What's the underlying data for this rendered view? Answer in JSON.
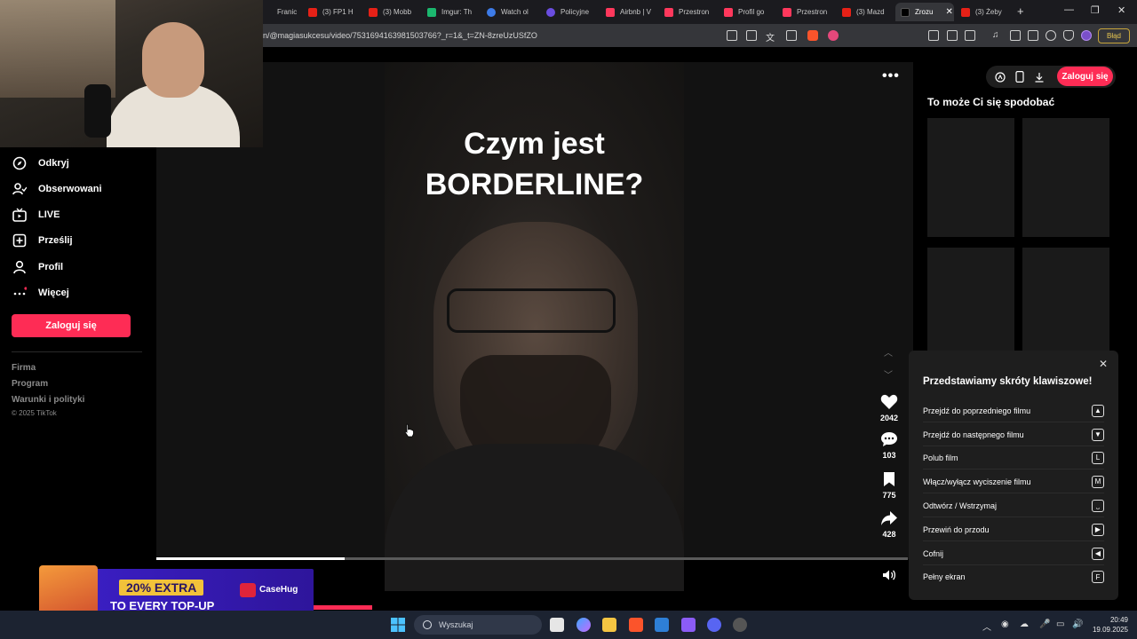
{
  "browser": {
    "tabs": [
      {
        "label": "Franic",
        "color": "#2a2a2a"
      },
      {
        "label": "(3) FP1 H",
        "color": "#e62117"
      },
      {
        "label": "(3) Mobb",
        "color": "#e62117"
      },
      {
        "label": "Imgur: Th",
        "color": "#1bb76e"
      },
      {
        "label": "Watch ol",
        "color": "#3d7be8"
      },
      {
        "label": "Policyjne",
        "color": "#6a4de0"
      },
      {
        "label": "Airbnb | V",
        "color": "#ff385c"
      },
      {
        "label": "Przestron",
        "color": "#ff385c"
      },
      {
        "label": "Profil go",
        "color": "#ff385c"
      },
      {
        "label": "Przestron",
        "color": "#ff385c"
      },
      {
        "label": "(3) Mazd",
        "color": "#e62117"
      },
      {
        "label": "Zrozu",
        "color": "#000000",
        "active": true
      },
      {
        "label": "(3) Żeby",
        "color": "#e62117"
      }
    ],
    "url": "n/@magiasukcesu/video/7531694163981503766?_r=1&_t=ZN-8zreUzUSfZO",
    "error_badge": "Błąd"
  },
  "sidebar": {
    "items": [
      {
        "label": "Odkryj",
        "icon": "compass-icon"
      },
      {
        "label": "Obserwowani",
        "icon": "following-icon"
      },
      {
        "label": "LIVE",
        "icon": "live-icon"
      },
      {
        "label": "Prześlij",
        "icon": "upload-icon"
      },
      {
        "label": "Profil",
        "icon": "profile-icon"
      },
      {
        "label": "Więcej",
        "icon": "more-icon"
      }
    ],
    "login_label": "Zaloguj się",
    "footer_links": [
      "Firma",
      "Program",
      "Warunki i polityki"
    ],
    "copyright": "© 2025 TikTok"
  },
  "video": {
    "title_line1": "Czym jest",
    "title_line2": "BORDERLINE?",
    "likes": "2042",
    "comments": "103",
    "saves": "775",
    "shares": "428",
    "progress": 0.25
  },
  "right_panel": {
    "login_label": "Zaloguj się",
    "recommend_title": "To może Ci się spodobać"
  },
  "shortcuts": {
    "title": "Przedstawiamy skróty klawiszowe!",
    "items": [
      {
        "label": "Przejdź do poprzedniego filmu",
        "key": "▲"
      },
      {
        "label": "Przejdź do następnego filmu",
        "key": "▼"
      },
      {
        "label": "Polub film",
        "key": "L"
      },
      {
        "label": "Włącz/wyłącz wyciszenie filmu",
        "key": "M"
      },
      {
        "label": "Odtwórz / Wstrzymaj",
        "key": "⎵"
      },
      {
        "label": "Przewiń do przodu",
        "key": "▶"
      },
      {
        "label": "Cofnij",
        "key": "◀"
      },
      {
        "label": "Pełny ekran",
        "key": "F"
      }
    ]
  },
  "ad": {
    "line1": "20% EXTRA",
    "line2": "TO EVERY TOP-UP",
    "brand": "CaseHug"
  },
  "taskbar": {
    "search_placeholder": "Wyszukaj",
    "time": "20:49",
    "date": "19.09.2025"
  }
}
